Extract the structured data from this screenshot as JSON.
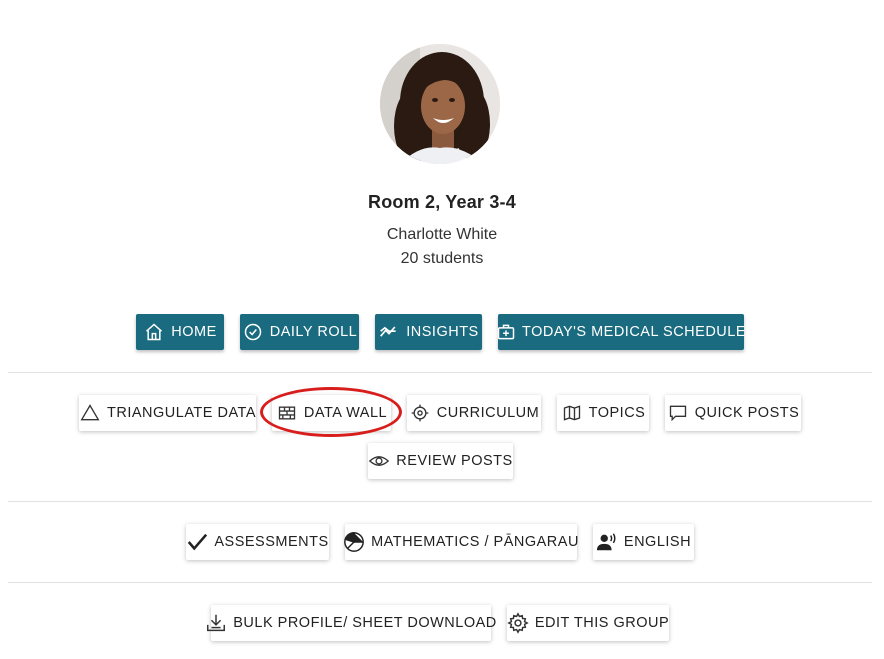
{
  "group": {
    "title": "Room 2, Year 3-4",
    "teacher": "Charlotte White",
    "students": "20 students"
  },
  "primary_nav": [
    {
      "label": "HOME",
      "icon": "home-icon"
    },
    {
      "label": "DAILY ROLL",
      "icon": "check-circle-icon"
    },
    {
      "label": "INSIGHTS",
      "icon": "insights-icon"
    },
    {
      "label": "TODAY'S MEDICAL SCHEDULE",
      "icon": "medical-kit-icon"
    }
  ],
  "data_nav": [
    {
      "label": "TRIANGULATE DATA",
      "icon": "triangle-icon"
    },
    {
      "label": "DATA WALL",
      "icon": "brick-wall-icon"
    },
    {
      "label": "CURRICULUM",
      "icon": "target-icon"
    },
    {
      "label": "TOPICS",
      "icon": "map-icon"
    },
    {
      "label": "QUICK POSTS",
      "icon": "comment-icon"
    },
    {
      "label": "REVIEW POSTS",
      "icon": "eye-icon"
    }
  ],
  "subject_nav": [
    {
      "label": "ASSESSMENTS",
      "icon": "checkmark-icon"
    },
    {
      "label": "MATHEMATICS / PĀNGARAU",
      "icon": "pie-chart-icon"
    },
    {
      "label": "ENGLISH",
      "icon": "speaking-person-icon"
    }
  ],
  "admin_nav": [
    {
      "label": "BULK PROFILE/ SHEET DOWNLOAD",
      "icon": "download-tray-icon"
    },
    {
      "label": "EDIT THIS GROUP",
      "icon": "gear-icon"
    }
  ],
  "colors": {
    "primary_button": "#1a6b7f",
    "highlight": "#d81d1d"
  }
}
